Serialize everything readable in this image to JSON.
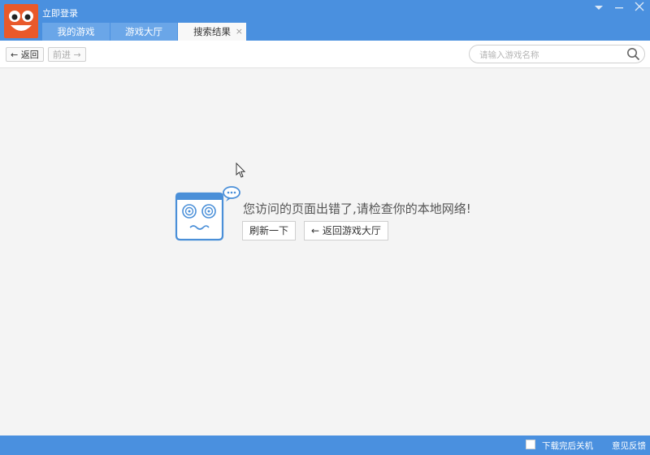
{
  "titlebar": {
    "login_label": "立即登录",
    "logo_icon": "smiley-logo-icon",
    "menu_icon": "dropdown-menu-icon",
    "minimize_icon": "minimize-icon",
    "close_icon": "close-icon"
  },
  "tabs": [
    {
      "label": "我的游戏"
    },
    {
      "label": "游戏大厅"
    },
    {
      "label": "搜索结果",
      "active": true,
      "close": "×"
    }
  ],
  "toolbar": {
    "back_label": "返回",
    "forward_label": "前进",
    "search_placeholder": "请输入游戏名称"
  },
  "content": {
    "error_message": "您访问的页面出错了,请检查你的本地网络!",
    "refresh_label": "刷新一下",
    "back_to_hall_label": "返回游戏大厅"
  },
  "statusbar": {
    "shutdown_label": "下载完后关机",
    "feedback_label": "意见反馈"
  },
  "colors": {
    "accent": "#4a90df",
    "logo": "#e9592a",
    "mascot": "#4a8fd8"
  }
}
